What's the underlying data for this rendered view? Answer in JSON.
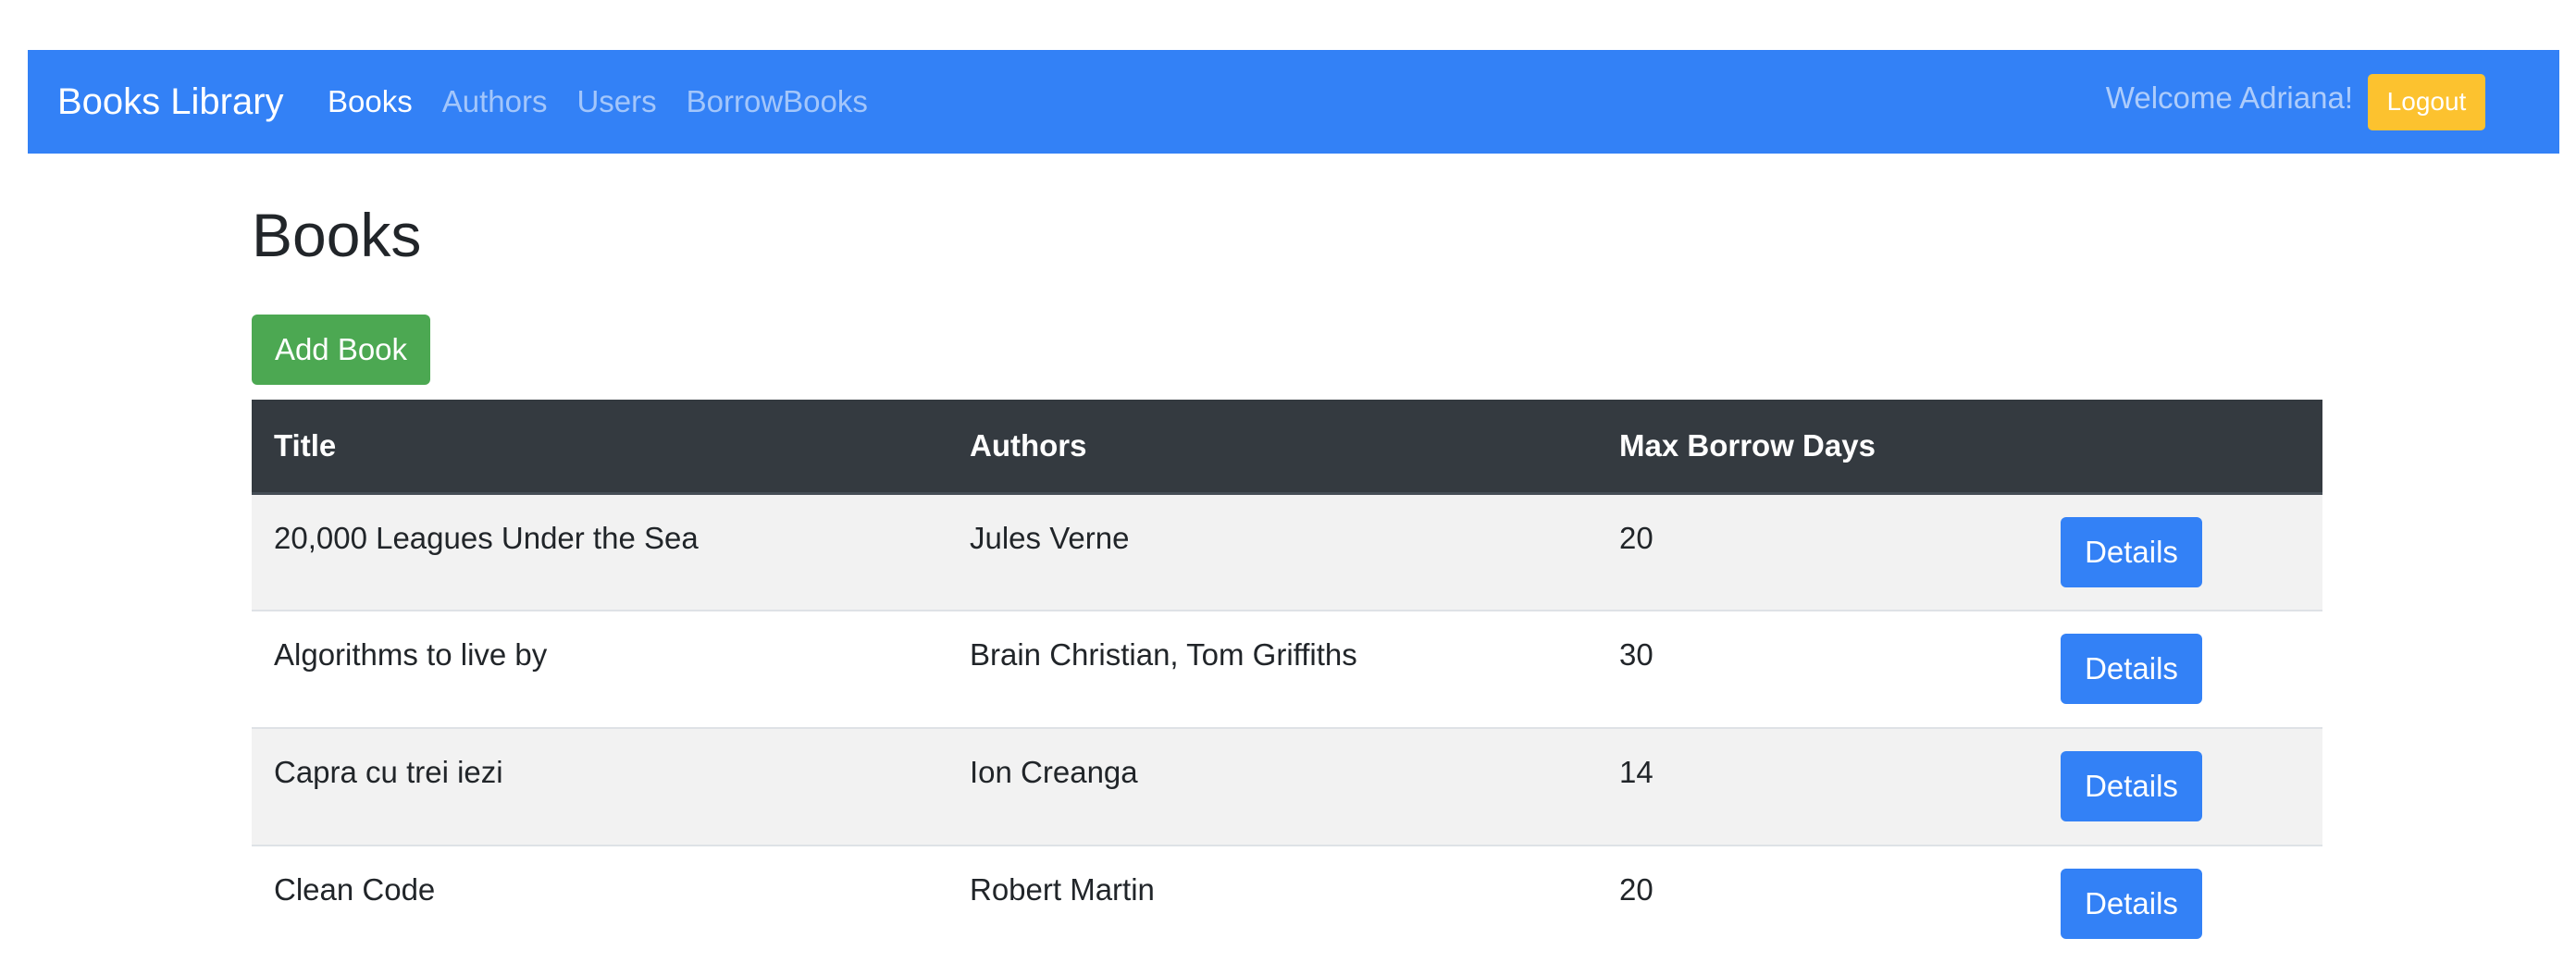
{
  "navbar": {
    "brand": "Books Library",
    "links": [
      {
        "label": "Books",
        "active": true
      },
      {
        "label": "Authors",
        "active": false
      },
      {
        "label": "Users",
        "active": false
      },
      {
        "label": "BorrowBooks",
        "active": false
      }
    ],
    "welcome": "Welcome Adriana!",
    "logout_label": "Logout"
  },
  "page": {
    "title": "Books",
    "add_label": "Add Book"
  },
  "table": {
    "headers": [
      "Title",
      "Authors",
      "Max Borrow Days",
      ""
    ],
    "rows": [
      {
        "title": "20,000 Leagues Under the Sea",
        "authors": "Jules Verne",
        "max_days": "20",
        "action": "Details"
      },
      {
        "title": "Algorithms to live by",
        "authors": "Brain Christian, Tom Griffiths",
        "max_days": "30",
        "action": "Details"
      },
      {
        "title": "Capra cu trei iezi",
        "authors": "Ion Creanga",
        "max_days": "14",
        "action": "Details"
      },
      {
        "title": "Clean Code",
        "authors": "Robert Martin",
        "max_days": "20",
        "action": "Details"
      }
    ]
  },
  "colors": {
    "navbar": "#3381f6",
    "logout": "#fcc22f",
    "add_button": "#4ca852",
    "table_header": "#343a40",
    "details_button": "#3381f6"
  }
}
